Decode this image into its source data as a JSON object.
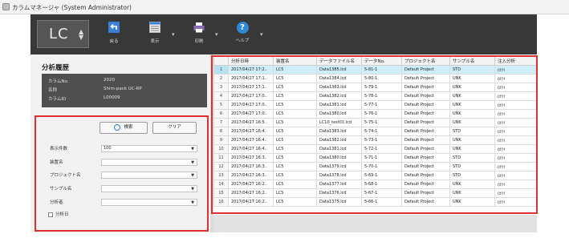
{
  "window": {
    "title": "カラムマネージャ (System Administrator)"
  },
  "toolbar": {
    "instrument": "LC",
    "buttons": [
      {
        "label": "戻る",
        "icon": "back-arrow-icon"
      },
      {
        "label": "表示",
        "icon": "view-list-icon"
      },
      {
        "label": "印刷",
        "icon": "printer-icon"
      },
      {
        "label": "ヘルプ",
        "icon": "help-icon"
      }
    ]
  },
  "panel": {
    "title": "分析履歴",
    "info": [
      {
        "key": "カラムNo.",
        "value": "2020"
      },
      {
        "key": "名称",
        "value": "Shim-pack UC-RP"
      },
      {
        "key": "カラムID",
        "value": "L00009"
      }
    ],
    "search_label": "検索",
    "clear_label": "クリア",
    "filters": [
      {
        "label": "表示件数",
        "value": "100"
      },
      {
        "label": "装置名",
        "value": ""
      },
      {
        "label": "プロジェクト名",
        "value": ""
      },
      {
        "label": "サンプル名",
        "value": ""
      },
      {
        "label": "分析者",
        "value": ""
      }
    ],
    "date_checkbox_label": "分析日"
  },
  "grid": {
    "columns": [
      "",
      "分析日時",
      "装置名",
      "データファイル名",
      "データNo.",
      "プロジェクト名",
      "サンプル名",
      "注入分析"
    ],
    "rows": [
      [
        "1",
        "2017/04/27 17:2..",
        "LC5",
        "Data1385.lcd",
        "5-81-1",
        "Default Project",
        "STD",
        "(ｶﾗｲ"
      ],
      [
        "2",
        "2017/04/27 17:1..",
        "LC5",
        "Data1384.lcd",
        "5-80-1",
        "Default Project",
        "UNK",
        "(ｶﾗｲ"
      ],
      [
        "3",
        "2017/04/27 17:1..",
        "LC5",
        "Data1383.lcd",
        "5-79-1",
        "Default Project",
        "UNK",
        "(ｶﾗｲ"
      ],
      [
        "4",
        "2017/04/27 17:0..",
        "LC5",
        "Data1382.lcd",
        "5-78-1",
        "Default Project",
        "UNK",
        "(ｶﾗｲ"
      ],
      [
        "5",
        "2017/04/27 17:0..",
        "LC5",
        "Data1381.lcd",
        "5-77-1",
        "Default Project",
        "UNK",
        "(ｶﾗｲ"
      ],
      [
        "6",
        "2017/04/27 17:0..",
        "LC5",
        "Data1380.lcd",
        "5-76-1",
        "Default Project",
        "UNK",
        "(ｶﾗｲ"
      ],
      [
        "7",
        "2017/04/27 16:5..",
        "LC5",
        "LC10_test01.lcd",
        "5-75-1",
        "Default Project",
        "UNK",
        "(ｶﾗｲ"
      ],
      [
        "8",
        "2017/04/27 16:4..",
        "LC5",
        "Data1383.lcd",
        "5-74-1",
        "Default Project",
        "STD",
        "(ｶﾗｲ"
      ],
      [
        "9",
        "2017/04/27 16:4..",
        "LC5",
        "Data1382.lcd",
        "5-73-1",
        "Default Project",
        "UNK",
        "(ｶﾗｲ"
      ],
      [
        "10",
        "2017/04/27 16:4..",
        "LC5",
        "Data1381.lcd",
        "5-72-1",
        "Default Project",
        "UNK",
        "(ｶﾗｲ"
      ],
      [
        "11",
        "2017/04/27 16:3..",
        "LC5",
        "Data1380.lcd",
        "5-71-1",
        "Default Project",
        "STD",
        "(ｶﾗｲ"
      ],
      [
        "12",
        "2017/04/27 16:3..",
        "LC5",
        "Data1379.lcd",
        "5-70-1",
        "Default Project",
        "STD",
        "(ｶﾗｲ"
      ],
      [
        "13",
        "2017/04/27 16:3..",
        "LC5",
        "Data1378.lcd",
        "5-69-1",
        "Default Project",
        "STD",
        "(ｶﾗｲ"
      ],
      [
        "14",
        "2017/04/27 16:2..",
        "LC5",
        "Data1377.lcd",
        "5-68-1",
        "Default Project",
        "UNK",
        "(ｶﾗｲ"
      ],
      [
        "15",
        "2017/04/27 16:2..",
        "LC5",
        "Data1376.lcd",
        "5-67-1",
        "Default Project",
        "UNK",
        "(ｶﾗｲ"
      ],
      [
        "16",
        "2017/04/27 16:2..",
        "LC5",
        "Data1375.lcd",
        "5-66-1",
        "Default Project",
        "UNK",
        "(ｶﾗｲ"
      ]
    ]
  },
  "colors": {
    "toolbar": "#383838",
    "highlight": "#e03030",
    "selected_row": "#cfeefa"
  }
}
